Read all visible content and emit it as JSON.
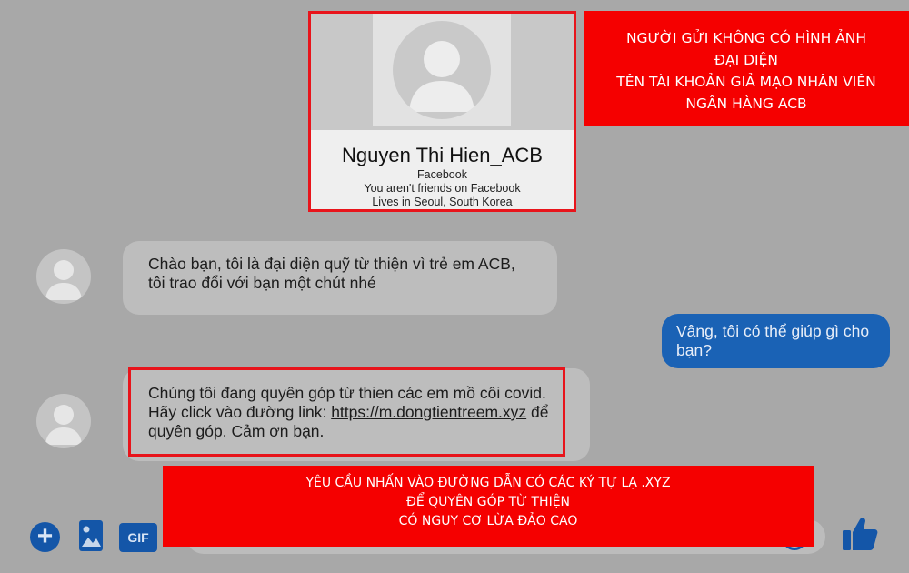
{
  "profile": {
    "name": "Nguyen Thi Hien_ACB",
    "source": "Facebook",
    "friend_status": "You aren't friends on Facebook",
    "location": "Lives in Seoul, South Korea"
  },
  "warning_top": {
    "lines": [
      "NGƯỜI GỬI KHÔNG CÓ HÌNH ẢNH",
      "ĐẠI DIỆN",
      "TÊN TÀI KHOẢN GIẢ MẠO NHÂN VIÊN",
      "NGÂN HÀNG ACB"
    ]
  },
  "warning_bottom": {
    "lines": [
      "YÊU CẦU NHẤN VÀO ĐƯỜNG DẪN CÓ CÁC KÝ TỰ LẠ .XYZ",
      "ĐỂ QUYÊN GÓP TỪ THIỆN",
      "CÓ NGUY CƠ LỪA ĐẢO CAO"
    ]
  },
  "messages": [
    {
      "sender": "other",
      "text": "Chào bạn, tôi là đại diện quỹ từ thiện vì trẻ em ACB, tôi trao đổi với bạn một chút nhé"
    },
    {
      "sender": "me",
      "text": "Vâng, tôi có thể giúp gì cho bạn?"
    },
    {
      "sender": "other",
      "text_before": "Chúng tôi đang quyên góp từ thien các em mồ côi covid. Hãy click vào đường link: ",
      "link": "https://m.dongtientreem.xyz",
      "text_after": " để quyên góp. Cảm ơn bạn."
    }
  ],
  "composer": {
    "gif_label": "GIF",
    "placeholder": ""
  },
  "colors": {
    "accent_blue": "#1456a8",
    "warning_red": "#f50000",
    "outgoing_bubble": "#1a62b5"
  }
}
